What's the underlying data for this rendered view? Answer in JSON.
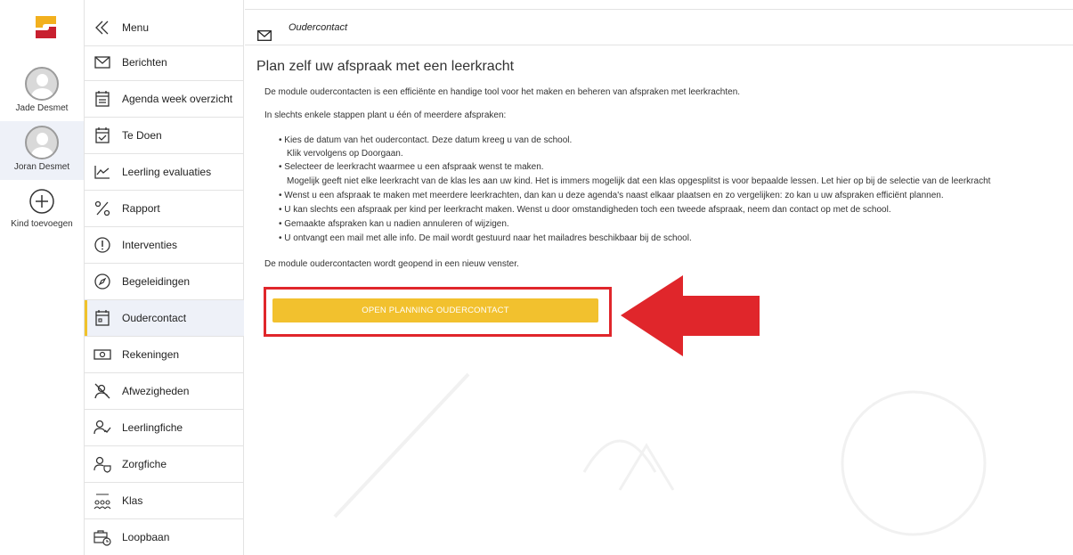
{
  "kids": [
    {
      "name": "Jade Desmet"
    },
    {
      "name": "Joran Desmet"
    },
    {
      "name": "Kind toevoegen"
    }
  ],
  "menu": {
    "items": [
      {
        "label": "Menu",
        "icon": "double-chevron-left-icon"
      },
      {
        "label": "Berichten",
        "icon": "envelope-icon"
      },
      {
        "label": "Agenda week overzicht",
        "icon": "calendar-list-icon"
      },
      {
        "label": "Te Doen",
        "icon": "calendar-check-icon"
      },
      {
        "label": "Leerling evaluaties",
        "icon": "chart-line-icon"
      },
      {
        "label": "Rapport",
        "icon": "percent-icon"
      },
      {
        "label": "Interventies",
        "icon": "exclamation-circle-icon"
      },
      {
        "label": "Begeleidingen",
        "icon": "compass-icon"
      },
      {
        "label": "Oudercontact",
        "icon": "calendar-day-icon"
      },
      {
        "label": "Rekeningen",
        "icon": "banknote-icon"
      },
      {
        "label": "Afwezigheden",
        "icon": "user-slash-icon"
      },
      {
        "label": "Leerlingfiche",
        "icon": "user-check-icon"
      },
      {
        "label": "Zorgfiche",
        "icon": "user-shield-icon"
      },
      {
        "label": "Klas",
        "icon": "group-icon"
      },
      {
        "label": "Loopbaan",
        "icon": "briefcase-clock-icon"
      }
    ]
  },
  "topbar": {
    "title": "Oudercontact"
  },
  "content": {
    "title": "Plan zelf uw afspraak met een leerkracht",
    "intro": "De module oudercontacten is een efficiënte en handige tool voor het maken en beheren van afspraken met leerkrachten.",
    "steps_intro": "In slechts enkele stappen plant u één of meerdere afspraken:",
    "bullets": [
      "• Kies de datum van het oudercontact. Deze datum kreeg u van de school.",
      "Klik vervolgens op Doorgaan.",
      "• Selecteer de leerkracht waarmee u een afspraak wenst te maken.",
      "Mogelijk geeft niet elke leerkracht van de klas les aan uw kind. Het is immers mogelijk dat een klas opgesplitst is voor bepaalde lessen. Let hier op bij de selectie van de leerkracht",
      "• Wenst u een afspraak te maken met meerdere leerkrachten, dan kan u deze agenda's naast elkaar plaatsen en zo vergelijken: zo kan u uw afspraken efficiënt plannen.",
      "• U kan slechts een afspraak per kind per leerkracht maken. Wenst u door omstandigheden toch een tweede afspraak, neem dan contact op met de school.",
      "• Gemaakte afspraken kan u nadien annuleren of wijzigen.",
      "• U ontvangt een mail met alle info. De mail wordt gestuurd naar het mailadres beschikbaar bij de school."
    ],
    "note": "De module oudercontacten wordt geopend in een nieuw venster.",
    "button_label": "OPEN PLANNING OUDERCONTACT"
  },
  "colors": {
    "accent": "#f2c12e",
    "highlight": "#e0262b",
    "active_bg": "#eef1f8"
  }
}
